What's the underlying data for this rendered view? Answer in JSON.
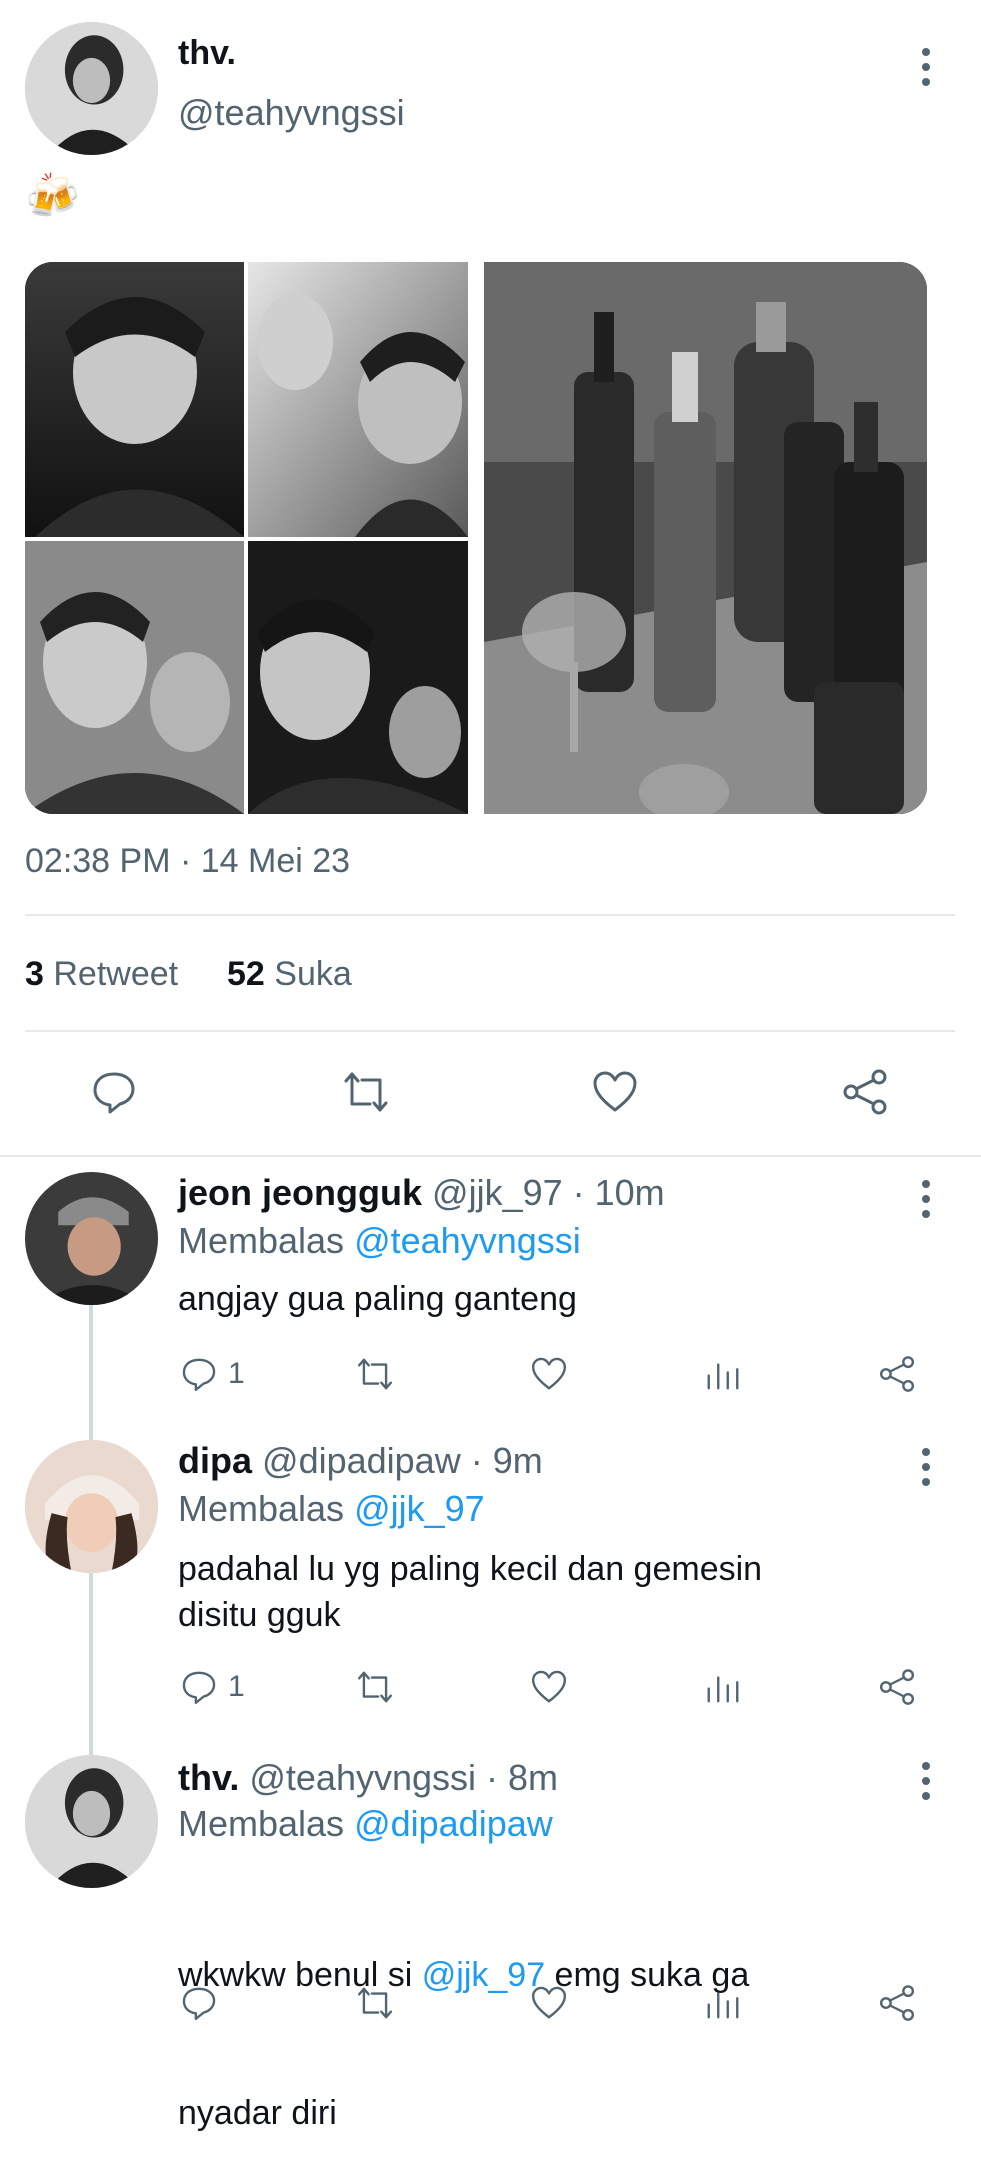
{
  "tweet": {
    "author_name": "thv.",
    "author_handle": "@teahyvngssi",
    "text": "🍻",
    "timestamp": "02:38 PM · 14 Mei 23",
    "retweet_count": "3",
    "retweet_label": "Retweet",
    "like_count": "52",
    "like_label": "Suka"
  },
  "replies": [
    {
      "name": "jeon jeongguk",
      "meta": "@jjk_97 · 10m",
      "replying_prefix": "Membalas",
      "replying_to": "@teahyvngssi",
      "text": "angjay gua paling ganteng",
      "reply_count": "1"
    },
    {
      "name": "dipa",
      "meta": "@dipadipaw · 9m",
      "replying_prefix": "Membalas",
      "replying_to": "@jjk_97",
      "text_line1": "padahal lu yg paling kecil dan gemesin",
      "text_line2": "disitu gguk",
      "reply_count": "1"
    },
    {
      "name": "thv.",
      "meta": "@teahyvngssi · 8m",
      "replying_prefix": "Membalas",
      "replying_to": "@dipadipaw",
      "text_pre": "wkwkw benul si ",
      "text_mention": "@jjk_97",
      "text_post": " emg suka ga",
      "text_line2": "nyadar diri"
    }
  ],
  "colors": {
    "accent": "#1d9bf0",
    "text": "#0f1419",
    "muted": "#536471",
    "divider": "#e7e9ea"
  },
  "icons": [
    "more-icon",
    "reply-icon",
    "retweet-icon",
    "like-icon",
    "share-icon",
    "analytics-icon",
    "beer-emoji"
  ]
}
